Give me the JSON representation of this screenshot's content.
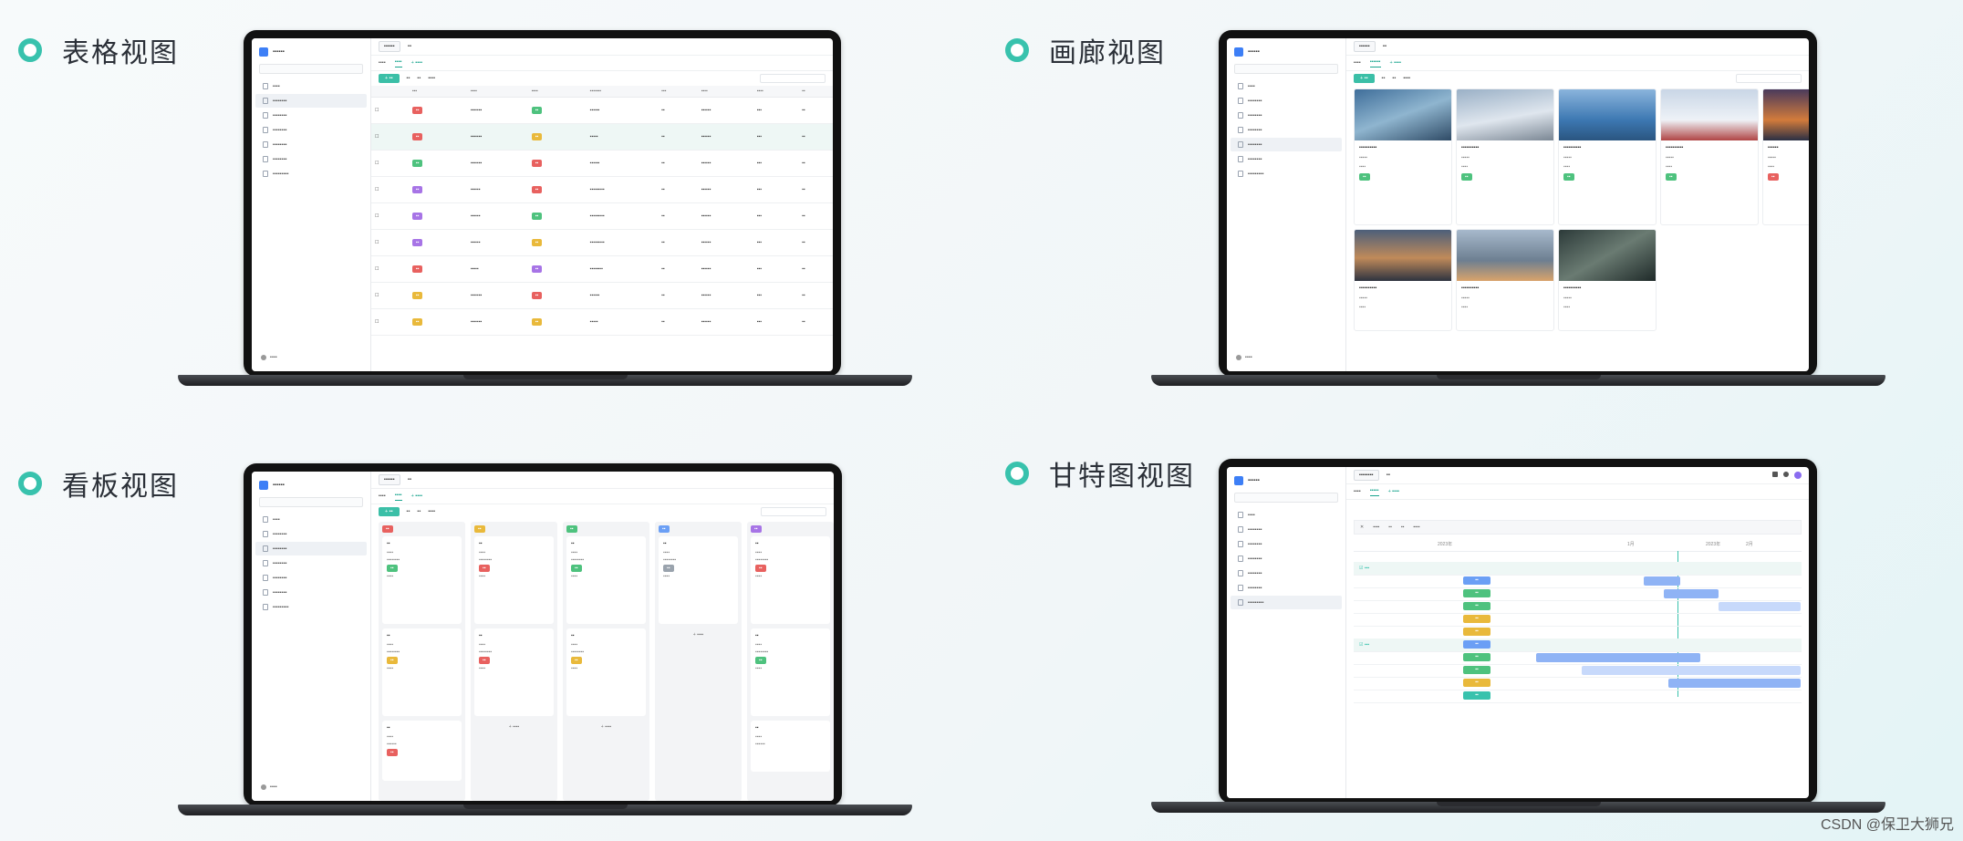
{
  "titles": {
    "table": "表格视图",
    "gallery": "画廊视图",
    "kanban": "看板视图",
    "gantt": "甘特图视图"
  },
  "watermark": "CSDN @保卫大狮兄",
  "colors": {
    "accent": "#38c2ad",
    "primary": "#3d7ff6",
    "tag_red": "#e8615f",
    "tag_green": "#4ec27e",
    "tag_yellow": "#e9b93b",
    "tag_purple": "#a774e6",
    "tag_blue": "#6b9ff5",
    "tag_grey": "#9aa3ad"
  },
  "gantt_ticks": [
    "2023年",
    "1月",
    "2023年",
    "2月"
  ]
}
